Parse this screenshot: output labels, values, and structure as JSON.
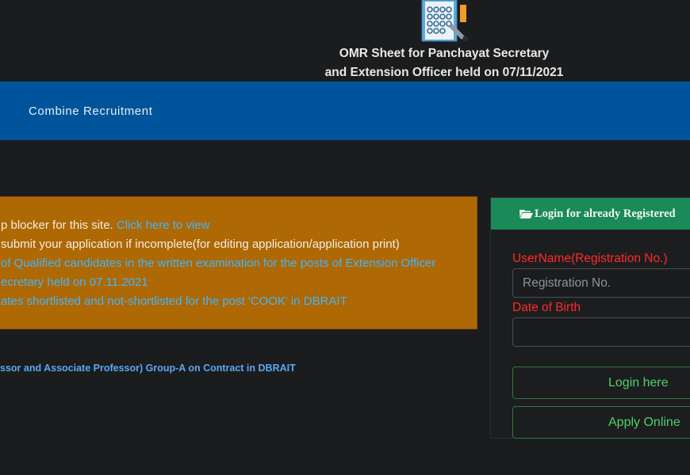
{
  "header": {
    "icon": "omr-sheet-icon",
    "title_line1": "OMR Sheet for Panchayat Secretary",
    "title_line2": "and Extension Officer held on 07/11/2021"
  },
  "nav": {
    "items": [
      {
        "label": "Combine Recruitment"
      }
    ]
  },
  "notices": {
    "line1_text": "p blocker for this site. ",
    "line1_link": "Click here to view",
    "line2": "submit your application if incomplete(for editing application/application print)",
    "line3": "of Qualified candidates in the written examination for the posts of Extension Officer",
    "line4": "ecretary held on 07.11.2021",
    "line5": "ates shortlisted and not-shortlisted for the post 'COOK' in DBRAIT"
  },
  "bottom_link": "ssor and Associate Professor) Group-A on Contract in DBRAIT",
  "login": {
    "header": "Login for already Registered",
    "header_icon": "folder-open-icon",
    "username_label": "UserName(Registration No.)",
    "username_placeholder": "Registration No.",
    "username_value": "",
    "dob_label": "Date of Birth",
    "dob_value": "",
    "login_button": "Login here",
    "apply_button": "Apply Online"
  },
  "colors": {
    "background": "#1b1c1e",
    "nav_bar": "#00549b",
    "notice_box": "#ae6804",
    "login_header": "#1a8a58",
    "link": "#40b6ff",
    "label_red": "#ff2a2a",
    "button_green": "#52d06a"
  }
}
